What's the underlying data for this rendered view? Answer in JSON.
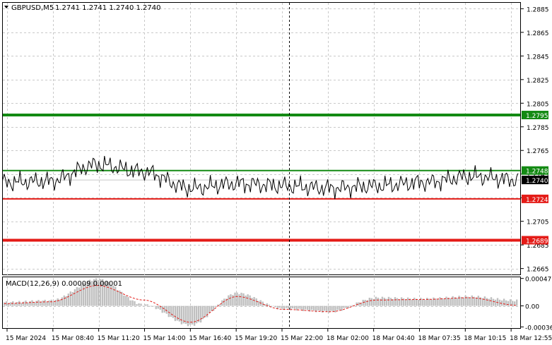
{
  "header": {
    "symbol": "GBPUSD,M5",
    "ohlc": "1.2741 1.2741 1.2740 1.2740"
  },
  "price_axis": {
    "ticks": [
      "1.2885",
      "1.2865",
      "1.2845",
      "1.2825",
      "1.2805",
      "1.2785",
      "1.2765",
      "1.2745",
      "1.2725",
      "1.2705",
      "1.2685",
      "1.2665"
    ]
  },
  "levels": [
    {
      "label": "1.2795",
      "value": 1.2795,
      "color": "#138a13",
      "style": "thick"
    },
    {
      "label": "1.2748",
      "value": 1.2748,
      "color": "#138a13",
      "style": "thin"
    },
    {
      "label": "1.2740",
      "value": 1.274,
      "color": "#000000",
      "style": "current"
    },
    {
      "label": "1.2724",
      "value": 1.2724,
      "color": "#e41b17",
      "style": "thin"
    },
    {
      "label": "1.2689",
      "value": 1.2689,
      "color": "#e41b17",
      "style": "thick"
    }
  ],
  "macd": {
    "label": "MACD(12,26,9) 0.00009 0.00001",
    "ticks": [
      "0.00047",
      "0.00",
      "-0.00036"
    ]
  },
  "time_axis": {
    "labels": [
      "15 Mar 2024",
      "15 Mar 08:40",
      "15 Mar 11:20",
      "15 Mar 14:00",
      "15 Mar 16:40",
      "15 Mar 19:20",
      "15 Mar 22:00",
      "18 Mar 02:00",
      "18 Mar 04:40",
      "18 Mar 07:35",
      "18 Mar 10:15",
      "18 Mar 12:55"
    ]
  },
  "colors": {
    "grid": "#c9c9c9",
    "price_line": "#000000",
    "histogram": "#c0c0c0",
    "signal": "#e41b17"
  },
  "chart_data": [
    {
      "type": "line",
      "title": "GBPUSD,M5",
      "ylim": [
        1.266,
        1.289
      ],
      "x": [
        "15 Mar 2024",
        "15 Mar 08:40",
        "15 Mar 11:20",
        "15 Mar 14:00",
        "15 Mar 16:40",
        "15 Mar 19:20",
        "15 Mar 22:00",
        "18 Mar 02:00",
        "18 Mar 04:40",
        "18 Mar 07:35",
        "18 Mar 10:15",
        "18 Mar 12:55"
      ],
      "series": [
        {
          "values": [
            1.2738,
            1.2739,
            1.2753,
            1.2747,
            1.2733,
            1.2737,
            1.2735,
            1.2733,
            1.2735,
            1.2738,
            1.2743,
            1.274
          ]
        }
      ]
    },
    {
      "type": "bar",
      "title": "MACD(12,26,9) 0.00009 0.00001",
      "ylim": [
        -0.00038,
        0.00049
      ],
      "x": [
        "15 Mar 2024",
        "15 Mar 08:40",
        "15 Mar 11:20",
        "15 Mar 14:00",
        "15 Mar 16:40",
        "15 Mar 19:20",
        "15 Mar 22:00",
        "18 Mar 02:00",
        "18 Mar 04:40",
        "18 Mar 07:35",
        "18 Mar 10:15",
        "18 Mar 12:55"
      ],
      "series": [
        {
          "values": [
            6e-05,
            9e-05,
            0.00046,
            2e-05,
            -0.00033,
            0.00022,
            -5e-05,
            -0.0001,
            0.00014,
            0.00012,
            0.00016,
            9e-05
          ]
        },
        {
          "values": [
            4e-05,
            7e-05,
            0.00035,
            0.0001,
            -0.00028,
            0.00016,
            -6e-05,
            -0.0001,
            0.0001,
            0.00011,
            0.00014,
            1e-05
          ]
        }
      ]
    }
  ]
}
